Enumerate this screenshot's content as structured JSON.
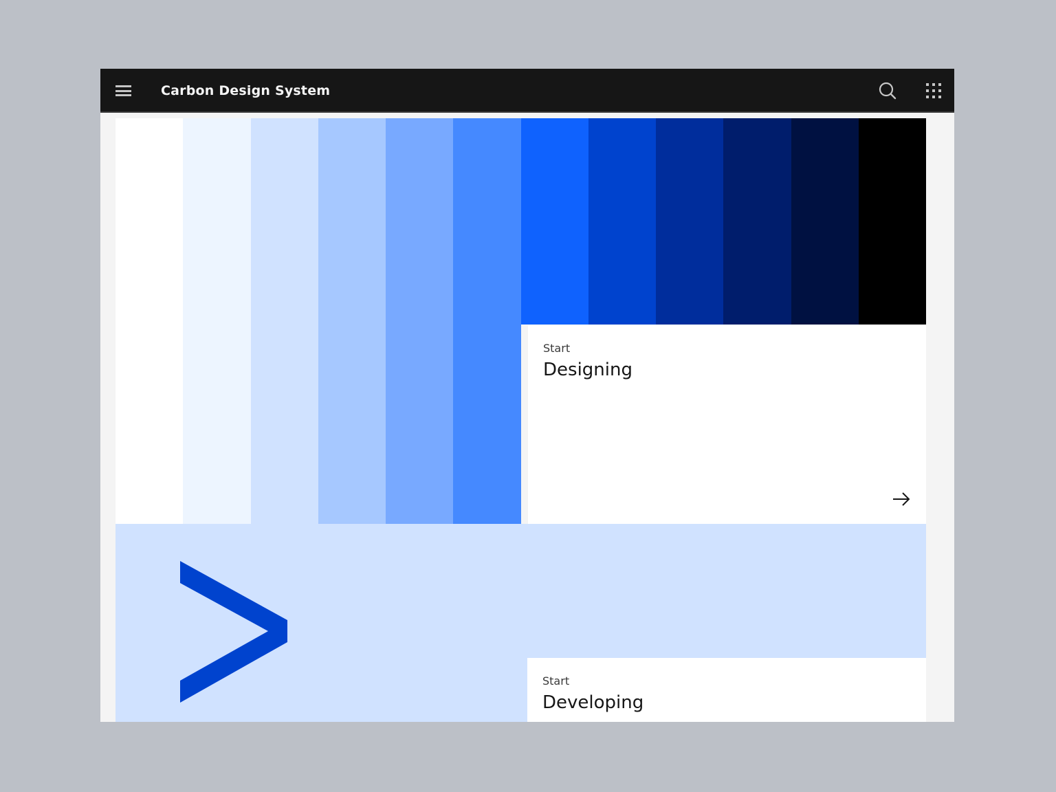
{
  "header": {
    "title": "Carbon Design System",
    "menu_icon": "hamburger-menu-icon",
    "search_icon": "search-icon",
    "switcher_icon": "app-switcher-grid-icon",
    "background": "#161616"
  },
  "hero": {
    "palette": [
      "#ffffff",
      "#edf5ff",
      "#d0e2ff",
      "#a6c8ff",
      "#78a9ff",
      "#4589ff",
      "#0f62fe",
      "#0043ce",
      "#002d9c",
      "#001d6c",
      "#001141",
      "#000000"
    ]
  },
  "tiles": {
    "designing": {
      "eyebrow": "Start",
      "title": "Designing",
      "arrow_icon": "arrow-right-icon"
    },
    "developing": {
      "eyebrow": "Start",
      "title": "Developing",
      "band_color": "#d0e2ff",
      "mark_icon": "chevron-right-icon",
      "mark_color": "#0043ce"
    }
  }
}
